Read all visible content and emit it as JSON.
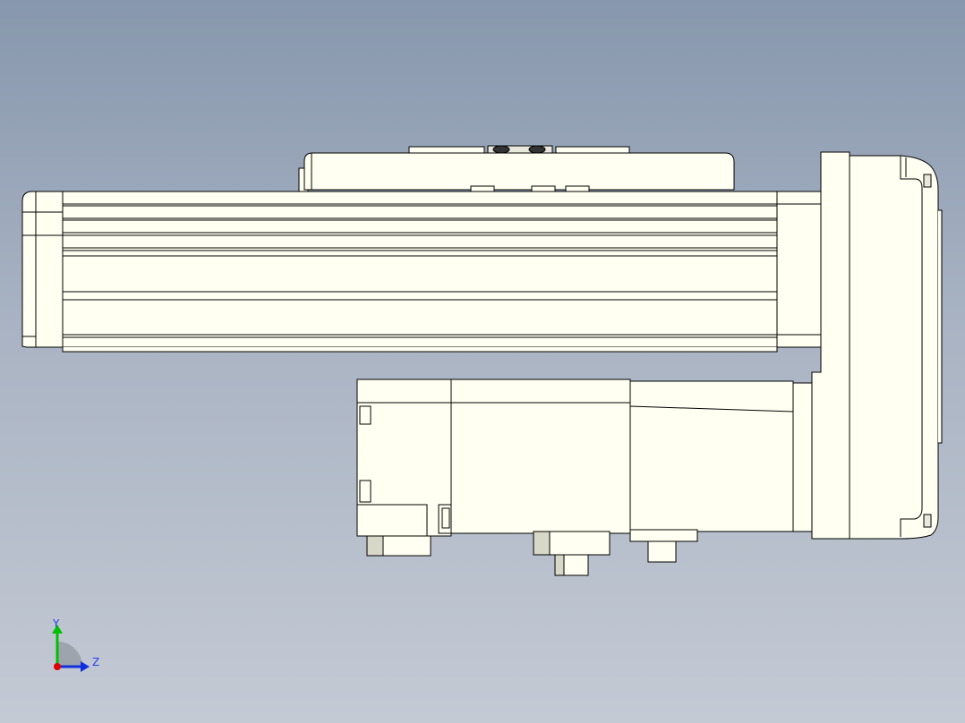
{
  "viewport": {
    "background_top": "#8797ad",
    "background_bottom": "#c4cad4"
  },
  "model": {
    "fill": "#fffff2",
    "edge": "#000000",
    "shadow": "#b8b8a8"
  },
  "triad": {
    "y_label": "Y",
    "z_label": "Z",
    "y_color": "#00c000",
    "z_color": "#1030e0",
    "x_color": "#e00000",
    "label_color": "#2a3df0"
  }
}
